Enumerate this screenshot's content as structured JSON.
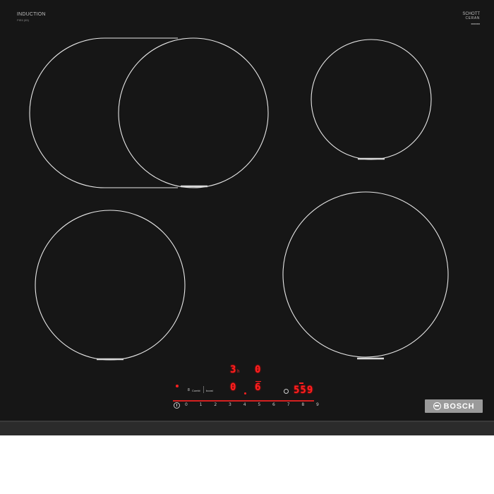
{
  "hob": {
    "top_left_title": "INDUCTION",
    "top_left_sub": "PIE6 (65)",
    "top_right_brand_1": "SCHOTT",
    "top_right_brand_2": "CERAN",
    "top_right_sub": "■■■■■■"
  },
  "display": {
    "front_left_level": "3",
    "front_left_residual": "h",
    "rear_right_level": "0",
    "bottom_left_level": "0",
    "bottom_right_level": "6",
    "timer_value": "559",
    "timer_colon": ":",
    "button_combi_label": "Combi",
    "button_boost_label": "boost"
  },
  "control": {
    "scale": [
      "0",
      "1",
      "2",
      "3",
      "4",
      "5",
      "6",
      "7",
      "8",
      "9"
    ]
  },
  "brand": {
    "logo_text": "BOSCH"
  },
  "colors": {
    "glass": "#161616",
    "display_red": "#ff2020",
    "zone_outline": "#e8e8e8",
    "logo_plate": "#9a9a9a"
  }
}
